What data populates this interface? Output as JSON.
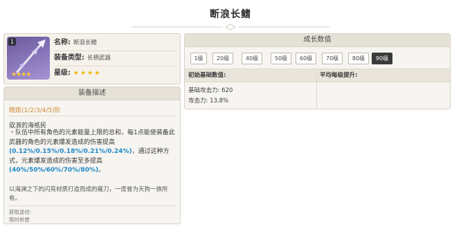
{
  "page": {
    "title": "断浪长鳍"
  },
  "item": {
    "rarity_badge": "1",
    "image_stars": "★★★★",
    "name_label": "名称:",
    "name_value": "断浪长鳍",
    "type_label": "装备类型:",
    "type_value": "长柄武器",
    "star_label": "星级:",
    "star_value": "★★★★",
    "star_count": 4
  },
  "description": {
    "header": "装备描述",
    "refine_label": "精炼(1/2/3/4/5)阶",
    "passive_name": "驭浪的海祇民",
    "passive_parts": [
      {
        "text": "・队伍中所有角色的元素能量上限的总和，每1点能使装备此武器的角色的元素爆发造成的伤害提高",
        "hl": false
      },
      {
        "text": "(0.12%/0.15%/0.18%/0.21%/0.24%)",
        "hl": true
      },
      {
        "text": "，通过这种方式，元素爆发造成的伤害至多提高",
        "hl": false
      },
      {
        "text": "(40%/50%/60%/70%/80%)",
        "hl": true
      },
      {
        "text": "。",
        "hl": false
      }
    ],
    "lore": "以海渊之下的闪亮材质打造而成的薙刀，一度曾为天狗一族所有。",
    "source_label": "获取途径:",
    "source_value": "限时祈愿"
  },
  "growth": {
    "header": "成长数值",
    "levels": [
      "1级",
      "20级",
      "40级",
      "50级",
      "60级",
      "70级",
      "80级",
      "90级"
    ],
    "active_level": "90级",
    "col_base": "初始基础数值:",
    "col_avg": "平均每级提升:",
    "base_atk": "基础攻击力: 620",
    "atk_pct": "攻击力: 13.8%"
  },
  "colors": {
    "highlight": "#1e88c7",
    "refine": "#d08a35",
    "star": "#f0b400",
    "active_level": "#3a3a3a"
  }
}
